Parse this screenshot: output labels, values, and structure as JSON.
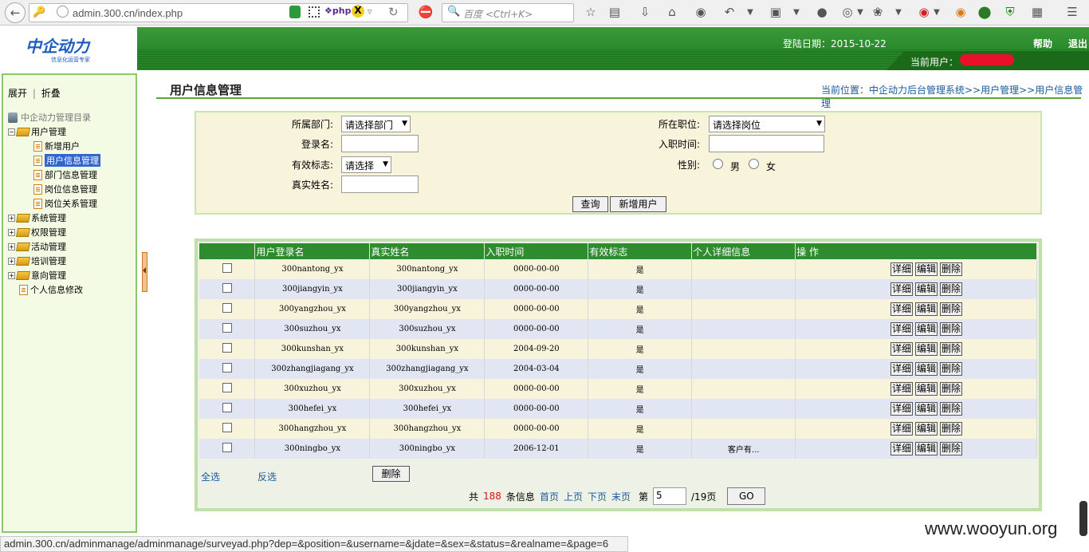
{
  "browser": {
    "url": "admin.300.cn/index.php",
    "search_placeholder": "百度 <Ctrl+K>",
    "status_url": "admin.300.cn/adminmanage/adminmanage/surveyad.php?dep=&position=&username=&jdate=&sex=&status=&realname=&page=6",
    "watermark": "www.wooyun.org"
  },
  "header": {
    "logo_text": "中企动力",
    "logo_sub": "信息化运营专家",
    "login_date": "登陆日期：2015-10-22",
    "help": "帮助",
    "logout": "退出",
    "current_user_label": "当前用户："
  },
  "sidebar": {
    "expand": "展开",
    "separator": "|",
    "collapse": "折叠",
    "root": "中企动力管理目录",
    "groups": [
      {
        "label": "用户管理",
        "children": [
          "新增用户",
          "用户信息管理",
          "部门信息管理",
          "岗位信息管理",
          "岗位关系管理"
        ]
      },
      {
        "label": "系统管理"
      },
      {
        "label": "权限管理"
      },
      {
        "label": "活动管理"
      },
      {
        "label": "培训管理"
      },
      {
        "label": "意向管理"
      }
    ],
    "last_item": "个人信息修改",
    "selected": "用户信息管理"
  },
  "main": {
    "title": "用户信息管理",
    "breadcrumb": "当前位置：中企动力后台管理系统>>用户管理>>用户信息管理"
  },
  "search": {
    "dept_label": "所属部门:",
    "dept_value": "请选择部门",
    "position_label": "所在职位:",
    "position_value": "请选择岗位",
    "login_label": "登录名:",
    "join_label": "入职时间:",
    "valid_label": "有效标志:",
    "valid_value": "请选择",
    "sex_label": "性别:",
    "male": "男",
    "female": "女",
    "realname_label": "真实姓名:",
    "query_btn": "查询",
    "add_btn": "新增用户"
  },
  "grid": {
    "columns": [
      "",
      "用户登录名",
      "真实姓名",
      "入职时间",
      "有效标志",
      "个人详细信息",
      "操 作"
    ],
    "actions": [
      "详细",
      "编辑",
      "删除"
    ],
    "rows": [
      {
        "login": "300nantong_yx",
        "name": "300nantong_yx",
        "date": "0000-00-00",
        "valid": "是",
        "info": ""
      },
      {
        "login": "300jiangyin_yx",
        "name": "300jiangyin_yx",
        "date": "0000-00-00",
        "valid": "是",
        "info": ""
      },
      {
        "login": "300yangzhou_yx",
        "name": "300yangzhou_yx",
        "date": "0000-00-00",
        "valid": "是",
        "info": ""
      },
      {
        "login": "300suzhou_yx",
        "name": "300suzhou_yx",
        "date": "0000-00-00",
        "valid": "是",
        "info": ""
      },
      {
        "login": "300kunshan_yx",
        "name": "300kunshan_yx",
        "date": "2004-09-20",
        "valid": "是",
        "info": ""
      },
      {
        "login": "300zhangjiagang_yx",
        "name": "300zhangjiagang_yx",
        "date": "2004-03-04",
        "valid": "是",
        "info": ""
      },
      {
        "login": "300xuzhou_yx",
        "name": "300xuzhou_yx",
        "date": "0000-00-00",
        "valid": "是",
        "info": ""
      },
      {
        "login": "300hefei_yx",
        "name": "300hefei_yx",
        "date": "0000-00-00",
        "valid": "是",
        "info": ""
      },
      {
        "login": "300hangzhou_yx",
        "name": "300hangzhou_yx",
        "date": "0000-00-00",
        "valid": "是",
        "info": ""
      },
      {
        "login": "300ningbo_yx",
        "name": "300ningbo_yx",
        "date": "2006-12-01",
        "valid": "是",
        "info": "客户有..."
      }
    ],
    "select_all": "全选",
    "invert": "反选",
    "delete_btn": "删除"
  },
  "pager": {
    "prefix": "共",
    "total": "188",
    "suffix": "条信息",
    "first": "首页",
    "prev": "上页",
    "next": "下页",
    "last": "末页",
    "page_label": "第",
    "page_value": "5",
    "pages": "/19页",
    "go": "GO"
  }
}
